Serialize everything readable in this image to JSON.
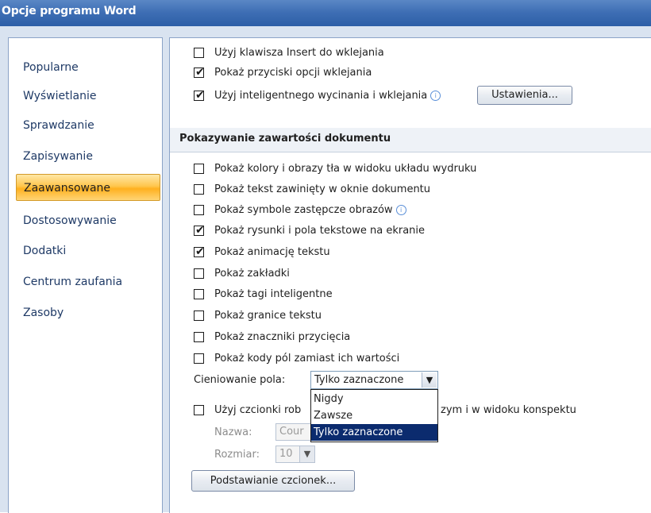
{
  "window": {
    "title": "Opcje programu Word"
  },
  "nav": {
    "items": [
      {
        "label": "Popularne",
        "active": false
      },
      {
        "label": "Wyświetlanie",
        "active": false
      },
      {
        "label": "Sprawdzanie",
        "active": false
      },
      {
        "label": "Zapisywanie",
        "active": false
      },
      {
        "label": "Zaawansowane",
        "active": true
      },
      {
        "label": "Dostosowywanie",
        "active": false
      },
      {
        "label": "Dodatki",
        "active": false
      },
      {
        "label": "Centrum zaufania",
        "active": false
      },
      {
        "label": "Zasoby",
        "active": false
      }
    ]
  },
  "paste_options": {
    "insert_key": {
      "label": "Użyj klawisza Insert do wklejania",
      "checked": false
    },
    "show_paste_buttons": {
      "label": "Pokaż przyciski opcji wklejania",
      "checked": true
    },
    "smart_cut_paste": {
      "label": "Użyj inteligentnego wycinania i wklejania",
      "checked": true
    },
    "settings_button": "Ustawienia..."
  },
  "document_content": {
    "section_title": "Pokazywanie zawartości dokumentu",
    "options": [
      {
        "label": "Pokaż kolory i obrazy tła w widoku układu wydruku",
        "checked": false
      },
      {
        "label": "Pokaż tekst zawinięty w oknie dokumentu",
        "checked": false
      },
      {
        "label": "Pokaż symbole zastępcze obrazów",
        "checked": false,
        "info": true
      },
      {
        "label": "Pokaż rysunki i pola tekstowe na ekranie",
        "checked": true
      },
      {
        "label": "Pokaż animację tekstu",
        "checked": true
      },
      {
        "label": "Pokaż zakładki",
        "checked": false
      },
      {
        "label": "Pokaż tagi inteligentne",
        "checked": false
      },
      {
        "label": "Pokaż granice tekstu",
        "checked": false
      },
      {
        "label": "Pokaż znaczniki przycięcia",
        "checked": false
      },
      {
        "label": "Pokaż kody pól zamiast ich wartości",
        "checked": false
      }
    ],
    "field_shading": {
      "label": "Cieniowanie pola:",
      "value": "Tylko zaznaczone",
      "options": [
        "Nigdy",
        "Zawsze",
        "Tylko zaznaczone"
      ]
    },
    "draft_font": {
      "label_start": "Użyj czcionki rob",
      "label_end": "zym i w widoku konspektu",
      "checked": false
    },
    "name_field": {
      "label": "Nazwa:",
      "value": "Cour"
    },
    "size_field": {
      "label": "Rozmiar:",
      "value": "10"
    },
    "font_substitution_button": "Podstawianie czcionek..."
  },
  "colors": {
    "title_bar": "#3f6fb5",
    "selection": "#0b2b6e",
    "active_nav": "#ffc64d"
  }
}
